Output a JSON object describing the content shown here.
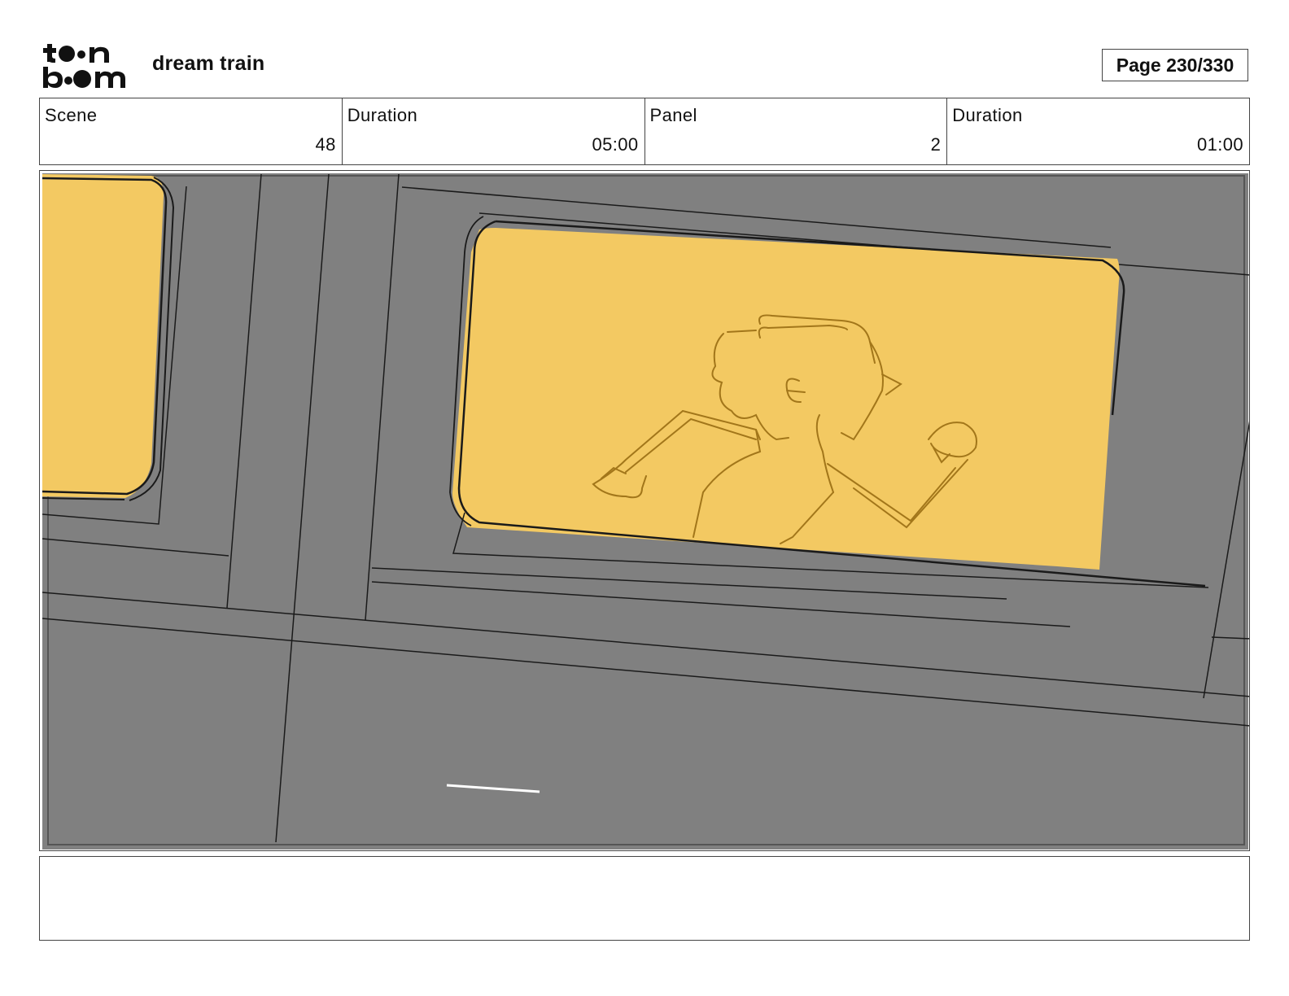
{
  "header": {
    "logo_text": "toonboom",
    "project_title": "dream train",
    "page_label": "Page 230/330"
  },
  "info": {
    "scene_label": "Scene",
    "scene_value": "48",
    "scene_duration_label": "Duration",
    "scene_duration_value": "05:00",
    "panel_label": "Panel",
    "panel_value": "2",
    "panel_duration_label": "Duration",
    "panel_duration_value": "01:00"
  },
  "drawing": {
    "description_icon": "storyboard-sketch",
    "colors": {
      "background": "#808080",
      "window": "#f3c962",
      "line": "#1a1a1a",
      "character_line": "#a2761a",
      "highlight": "#ffffff"
    }
  },
  "notes": {
    "text": ""
  }
}
